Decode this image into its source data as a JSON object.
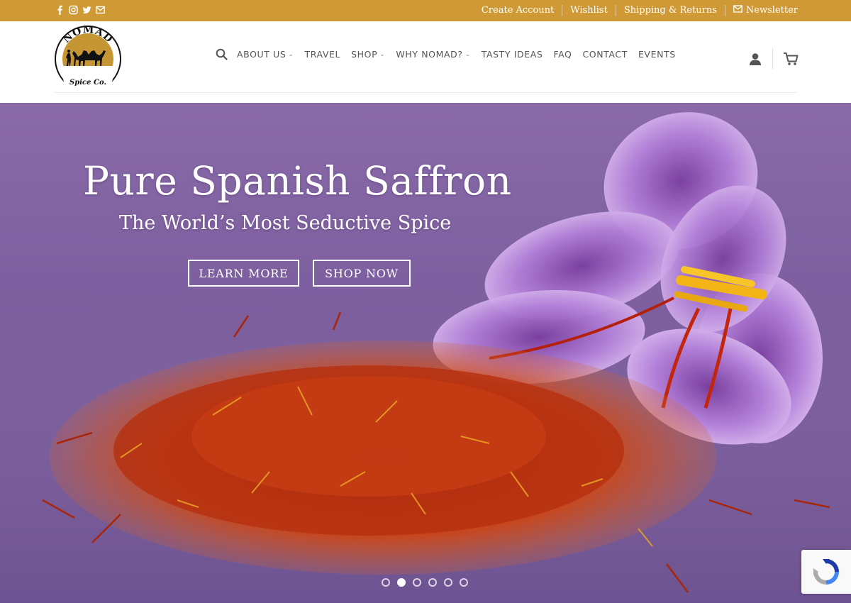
{
  "colors": {
    "topbar": "#cf9a35",
    "hero_purple": "#7e60a0",
    "nav_text": "#555555"
  },
  "topbar": {
    "social_icons": [
      "facebook-icon",
      "instagram-icon",
      "twitter-icon",
      "envelope-icon"
    ],
    "links": {
      "create_account": "Create Account",
      "wishlist": "Wishlist",
      "shipping": "Shipping & Returns",
      "newsletter": "Newsletter"
    }
  },
  "logo": {
    "top_text": "NOMAD",
    "bottom_text": "Spice Co."
  },
  "nav": {
    "about": "ABOUT US",
    "travel": "TRAVEL",
    "shop": "SHOP",
    "why": "WHY NOMAD?",
    "tasty": "TASTY IDEAS",
    "faq": "FAQ",
    "contact": "CONTACT",
    "events": "EVENTS"
  },
  "hero": {
    "title": "Pure Spanish Saffron",
    "subtitle": "The World’s Most Seductive Spice",
    "learn_more": "LEARN MORE",
    "shop_now": "SHOP NOW",
    "slide_count": 6,
    "active_slide": 2
  }
}
